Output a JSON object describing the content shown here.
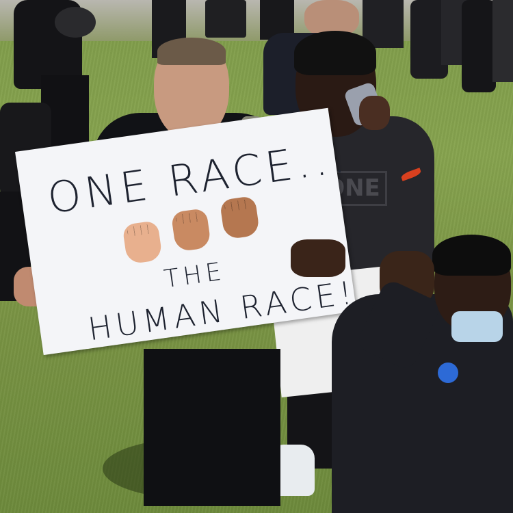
{
  "photo": {
    "sign": {
      "line1": "ONE RACE...",
      "line2": "THE",
      "line3": "HUMAN RACE!"
    },
    "shirt_text": "ONE",
    "fist_colors": [
      "#e8b08e",
      "#c98a62",
      "#b57750"
    ]
  }
}
